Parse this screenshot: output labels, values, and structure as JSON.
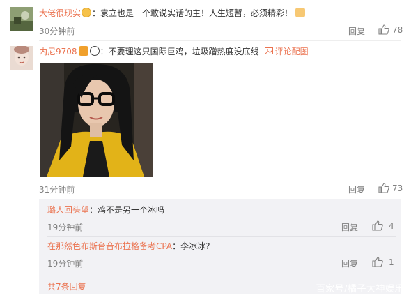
{
  "comments": [
    {
      "user": "大佬很现实",
      "colon": "：",
      "text": "袁立也是一个敢说实话的主！人生短暂，必须精彩！",
      "time": "30分钟前",
      "reply_label": "回复",
      "likes": "78",
      "emoji_icon": "smile-emoji-icon",
      "thumb_icon": "thumbs-up-emoji-icon"
    },
    {
      "user": "内尼9708",
      "colon": "：",
      "text": "不要理这只国际巨鸡，垃圾蹭热度没底线",
      "pic_link": "评论配图",
      "time": "31分钟前",
      "reply_label": "回复",
      "likes": "73",
      "replies": [
        {
          "user": "璐人回头望",
          "colon": "：",
          "text": "鸡不是另一个冰吗",
          "time": "19分钟前",
          "reply_label": "回复",
          "likes": "4"
        },
        {
          "user": "在那然色布斯台音布拉格备考CPA",
          "colon": "：",
          "text": "李冰冰?",
          "time": "19分钟前",
          "reply_label": "回复",
          "likes": "1"
        }
      ],
      "more_replies": "共7条回复"
    }
  ],
  "watermark": "百家号/橘子大神娱乐",
  "colors": {
    "accent": "#eb7350",
    "muted": "#808080",
    "subbox": "#f2f2f5"
  }
}
